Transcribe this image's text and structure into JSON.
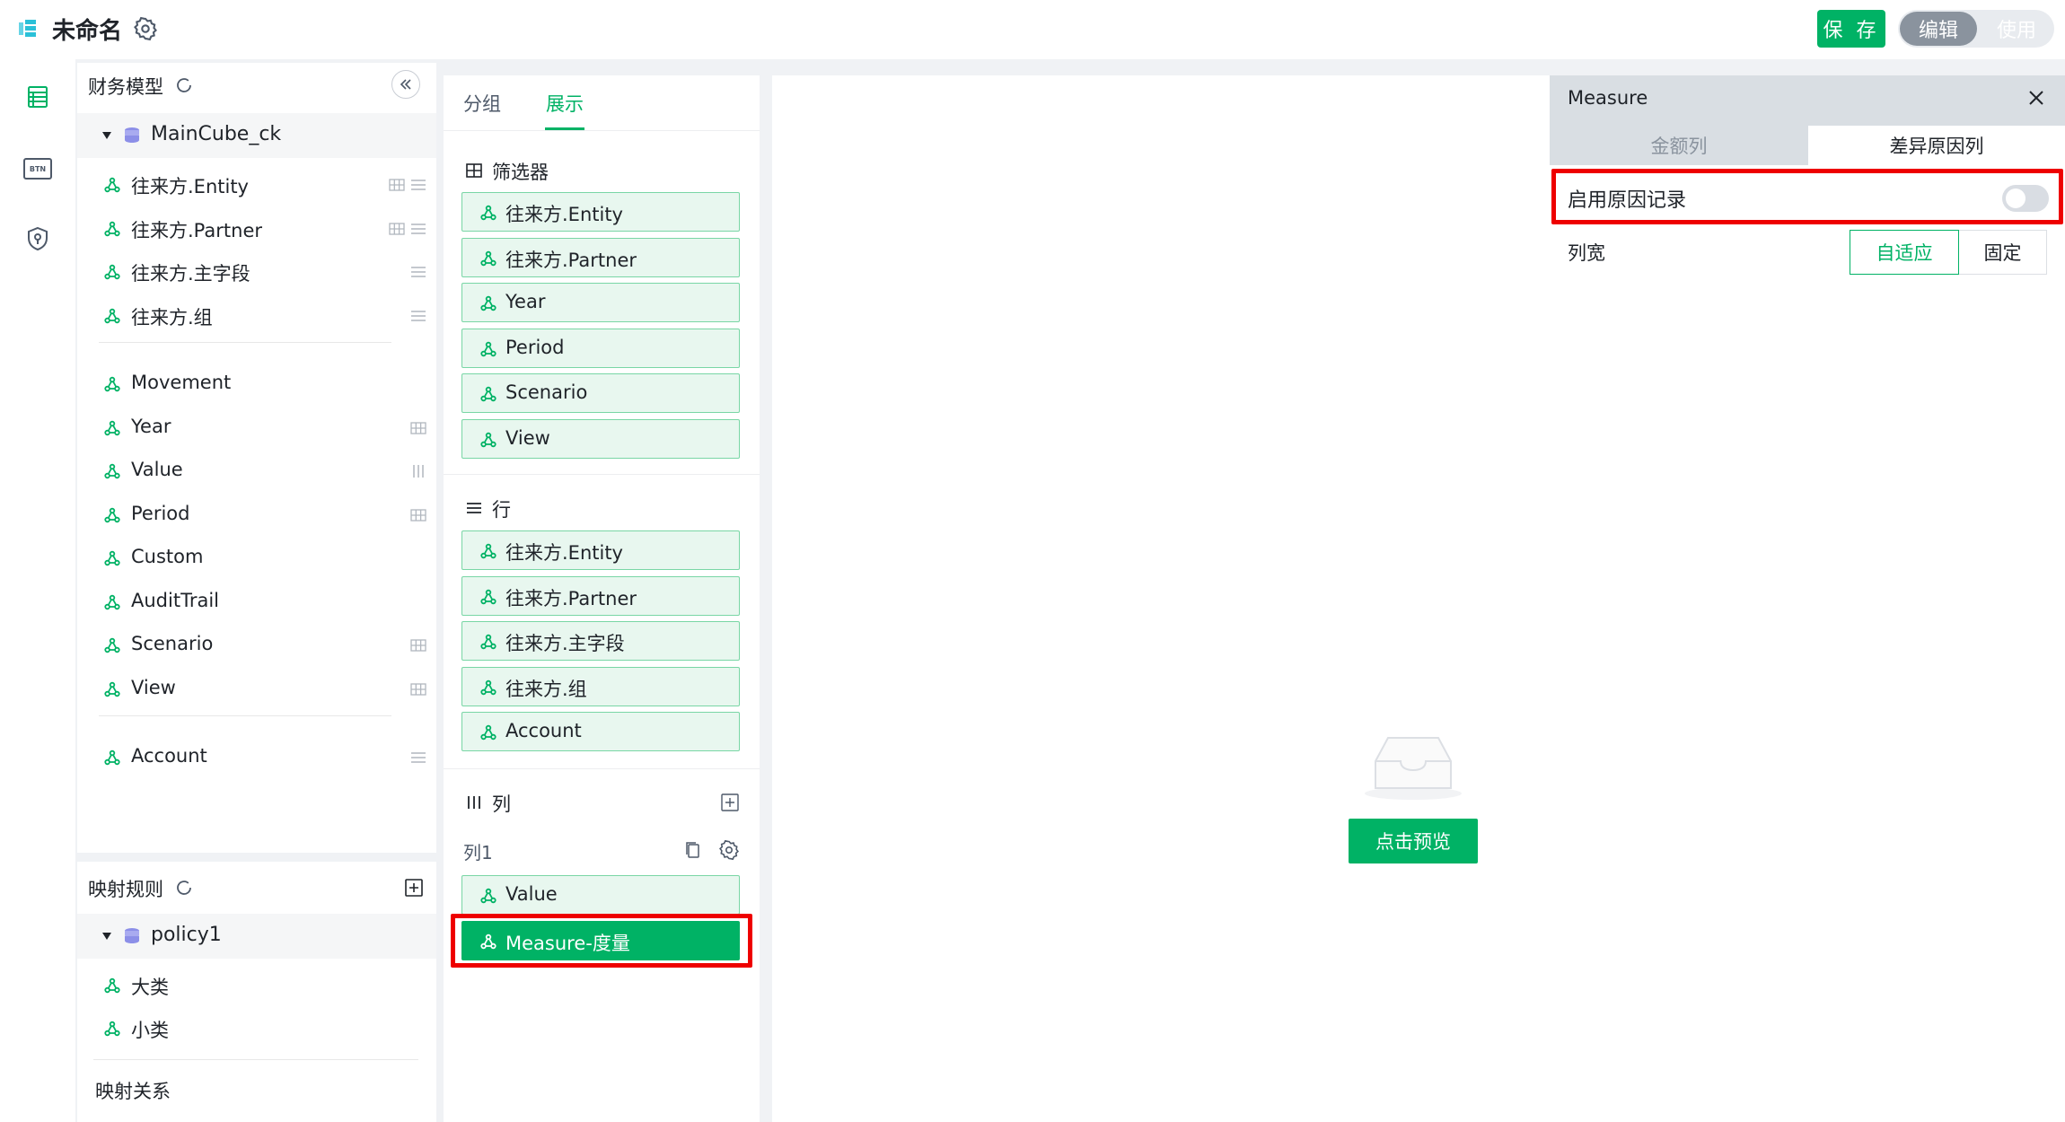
{
  "header": {
    "title": "未命名",
    "save_label": "保 存",
    "mode_edit": "编辑",
    "mode_use": "使用"
  },
  "rail": {
    "icons": [
      "table-icon",
      "btn-icon",
      "shield-icon"
    ],
    "btn_text": "BTN"
  },
  "left_panel": {
    "title": "财务模型",
    "root": "MainCube_ck",
    "groups": [
      [
        {
          "label": "往来方.Entity",
          "trail": "grid-list"
        },
        {
          "label": "往来方.Partner",
          "trail": "grid-list"
        },
        {
          "label": "往来方.主字段",
          "trail": "list"
        },
        {
          "label": "往来方.组",
          "trail": "list"
        }
      ],
      [
        {
          "label": "Movement",
          "trail": ""
        },
        {
          "label": "Year",
          "trail": "grid"
        },
        {
          "label": "Value",
          "trail": "columns"
        },
        {
          "label": "Period",
          "trail": "grid"
        },
        {
          "label": "Custom",
          "trail": ""
        },
        {
          "label": "AuditTrail",
          "trail": ""
        },
        {
          "label": "Scenario",
          "trail": "grid"
        },
        {
          "label": "View",
          "trail": "grid"
        }
      ],
      [
        {
          "label": "Account",
          "trail": "list"
        }
      ]
    ]
  },
  "mapping_panel": {
    "title": "映射规则",
    "root": "policy1",
    "items": [
      "大类",
      "小类"
    ],
    "relation_title": "映射关系"
  },
  "middle_panel": {
    "tabs": [
      "分组",
      "展示"
    ],
    "active_tab": 1,
    "filter": {
      "title": "筛选器",
      "chips": [
        "往来方.Entity",
        "往来方.Partner",
        "Year",
        "Period",
        "Scenario",
        "View"
      ]
    },
    "rows": {
      "title": "行",
      "chips": [
        "往来方.Entity",
        "往来方.Partner",
        "往来方.主字段",
        "往来方.组",
        "Account"
      ]
    },
    "columns": {
      "title": "列",
      "col_name": "列1",
      "chips": [
        "Value",
        "Measure-度量"
      ],
      "selected": 1
    }
  },
  "canvas": {
    "preview_label": "点击预览"
  },
  "right_panel": {
    "title": "Measure",
    "tabs": [
      "金额列",
      "差异原因列"
    ],
    "active_tab": 1,
    "enable_reason_label": "启用原因记录",
    "enable_reason_on": false,
    "column_width_label": "列宽",
    "width_options": [
      "自适应",
      "固定"
    ],
    "width_selected": 0
  },
  "colors": {
    "accent": "#00b265",
    "highlight": "#ee0000",
    "chip_bg": "#e8f7ef",
    "chip_border": "#79d6a5"
  }
}
